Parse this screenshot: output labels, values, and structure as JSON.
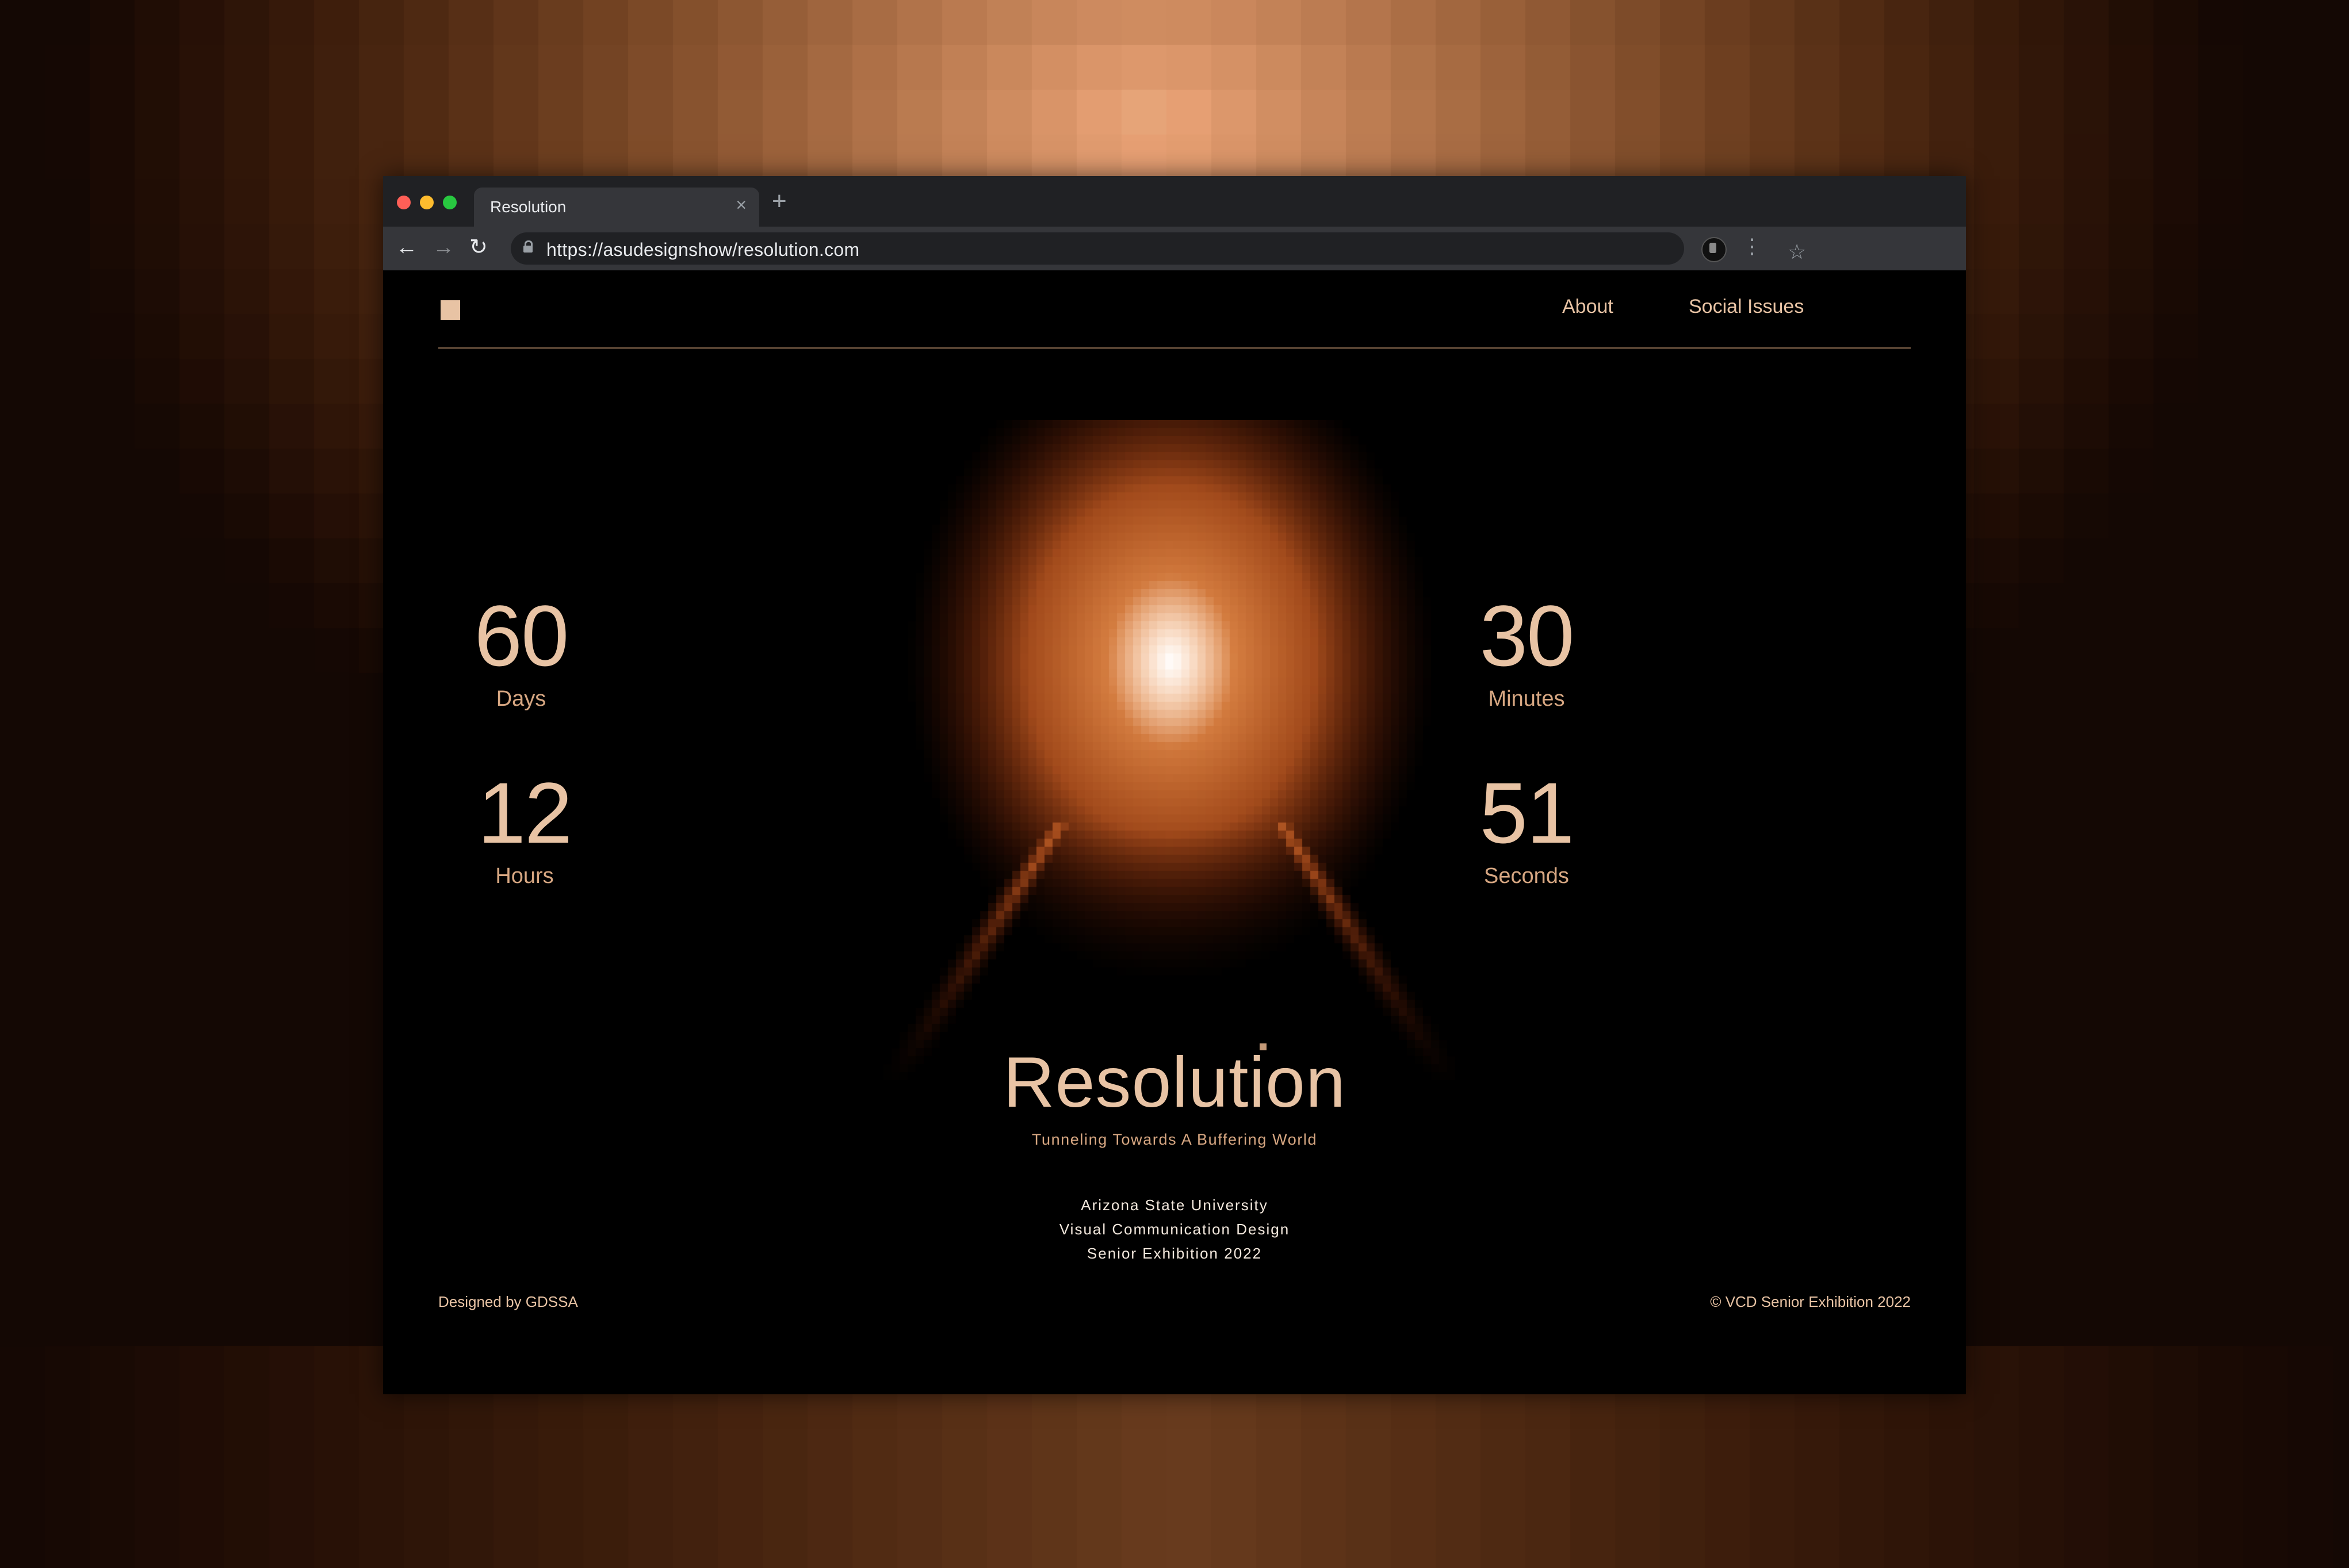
{
  "browser": {
    "tab_title": "Resolution",
    "tab_close": "×",
    "new_tab": "+",
    "url": "https://asudesignshow/resolution.com",
    "back": "←",
    "forward": "→",
    "reload": "↻",
    "bookmark": "☆",
    "menu": "⋮"
  },
  "site": {
    "nav": {
      "about": "About",
      "social": "Social Issues"
    },
    "countdown": [
      {
        "value": "60",
        "label": "Days"
      },
      {
        "value": "12",
        "label": "Hours"
      },
      {
        "value": "30",
        "label": "Minutes"
      },
      {
        "value": "51",
        "label": "Seconds"
      }
    ],
    "title": "Resolution",
    "tagline": "Tunneling Towards A Buffering World",
    "info": [
      "Arizona State University",
      "Visual Communication Design",
      "Senior Exhibition 2022"
    ],
    "footer": {
      "left": "Designed by GDSSA",
      "right": "© VCD Senior Exhibition 2022"
    }
  },
  "colors": {
    "accent": "#e8c3a4",
    "label": "#d7a782",
    "page_bg": "#000000",
    "chrome_dark": "#202124",
    "chrome_tab": "#35363a"
  },
  "icons": [
    "back-arrow-icon",
    "forward-arrow-icon",
    "reload-icon",
    "lock-icon",
    "star-icon",
    "profile-icon",
    "menu-icon",
    "close-icon",
    "plus-icon",
    "logo-square-icon"
  ]
}
